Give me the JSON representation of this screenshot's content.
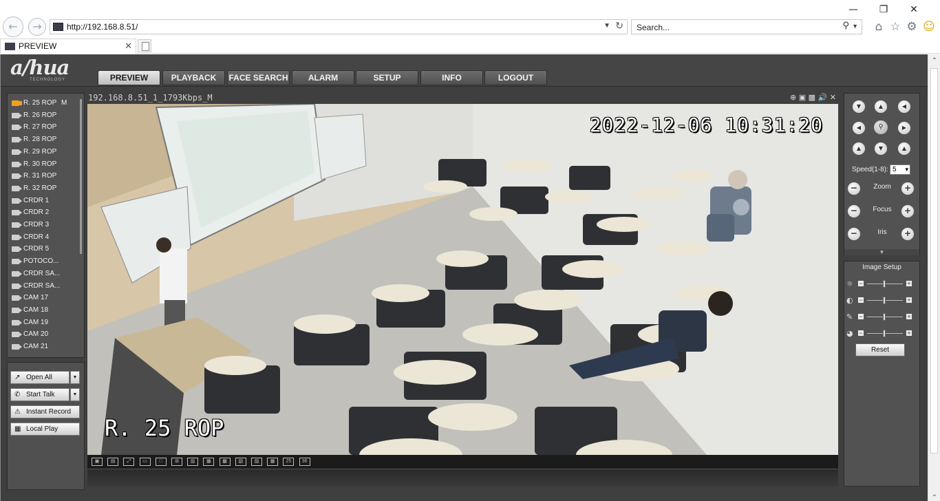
{
  "browser": {
    "url": "http://192.168.8.51/",
    "search_placeholder": "Search...",
    "tab_title": "PREVIEW"
  },
  "nav": {
    "tabs": [
      "PREVIEW",
      "PLAYBACK",
      "FACE SEARCH",
      "ALARM",
      "SETUP",
      "INFO",
      "LOGOUT"
    ],
    "active": "PREVIEW"
  },
  "channels": [
    {
      "label": "R. 25 ROP",
      "mode": "M",
      "active": true
    },
    {
      "label": "R. 26 ROP"
    },
    {
      "label": "R. 27 ROP"
    },
    {
      "label": "R. 28 ROP"
    },
    {
      "label": "R. 29 ROP"
    },
    {
      "label": "R. 30 ROP"
    },
    {
      "label": "R. 31 ROP"
    },
    {
      "label": "R. 32 ROP"
    },
    {
      "label": "CRDR 1"
    },
    {
      "label": "CRDR 2"
    },
    {
      "label": "CRDR 3"
    },
    {
      "label": "CRDR 4"
    },
    {
      "label": "CRDR 5"
    },
    {
      "label": "POTOCO..."
    },
    {
      "label": "CRDR SA..."
    },
    {
      "label": "CRDR SA..."
    },
    {
      "label": "CAM 17"
    },
    {
      "label": "CAM 18"
    },
    {
      "label": "CAM 19"
    },
    {
      "label": "CAM 20"
    },
    {
      "label": "CAM 21"
    }
  ],
  "actions": {
    "open_all": "Open All",
    "start_talk": "Start Talk",
    "instant_record": "Instant Record",
    "local_play": "Local Play"
  },
  "video": {
    "stream_label": "192.168.8.51_1_1793Kbps_M",
    "osd_time": "2022-12-06 10:31:20",
    "osd_name": "R. 25 ROP"
  },
  "split_modes": [
    "1x1",
    "2x2",
    "fit",
    "wide",
    "1",
    "4",
    "6",
    "8",
    "9",
    "13",
    "16",
    "20",
    "25",
    "36"
  ],
  "ptz": {
    "speed_label": "Speed(1-8):",
    "speed_value": "5",
    "zoom_label": "Zoom",
    "focus_label": "Focus",
    "iris_label": "Iris"
  },
  "image_setup": {
    "title": "Image Setup",
    "reset_label": "Reset",
    "rows": [
      "brightness-icon",
      "contrast-icon",
      "saturation-icon",
      "hue-icon"
    ]
  }
}
